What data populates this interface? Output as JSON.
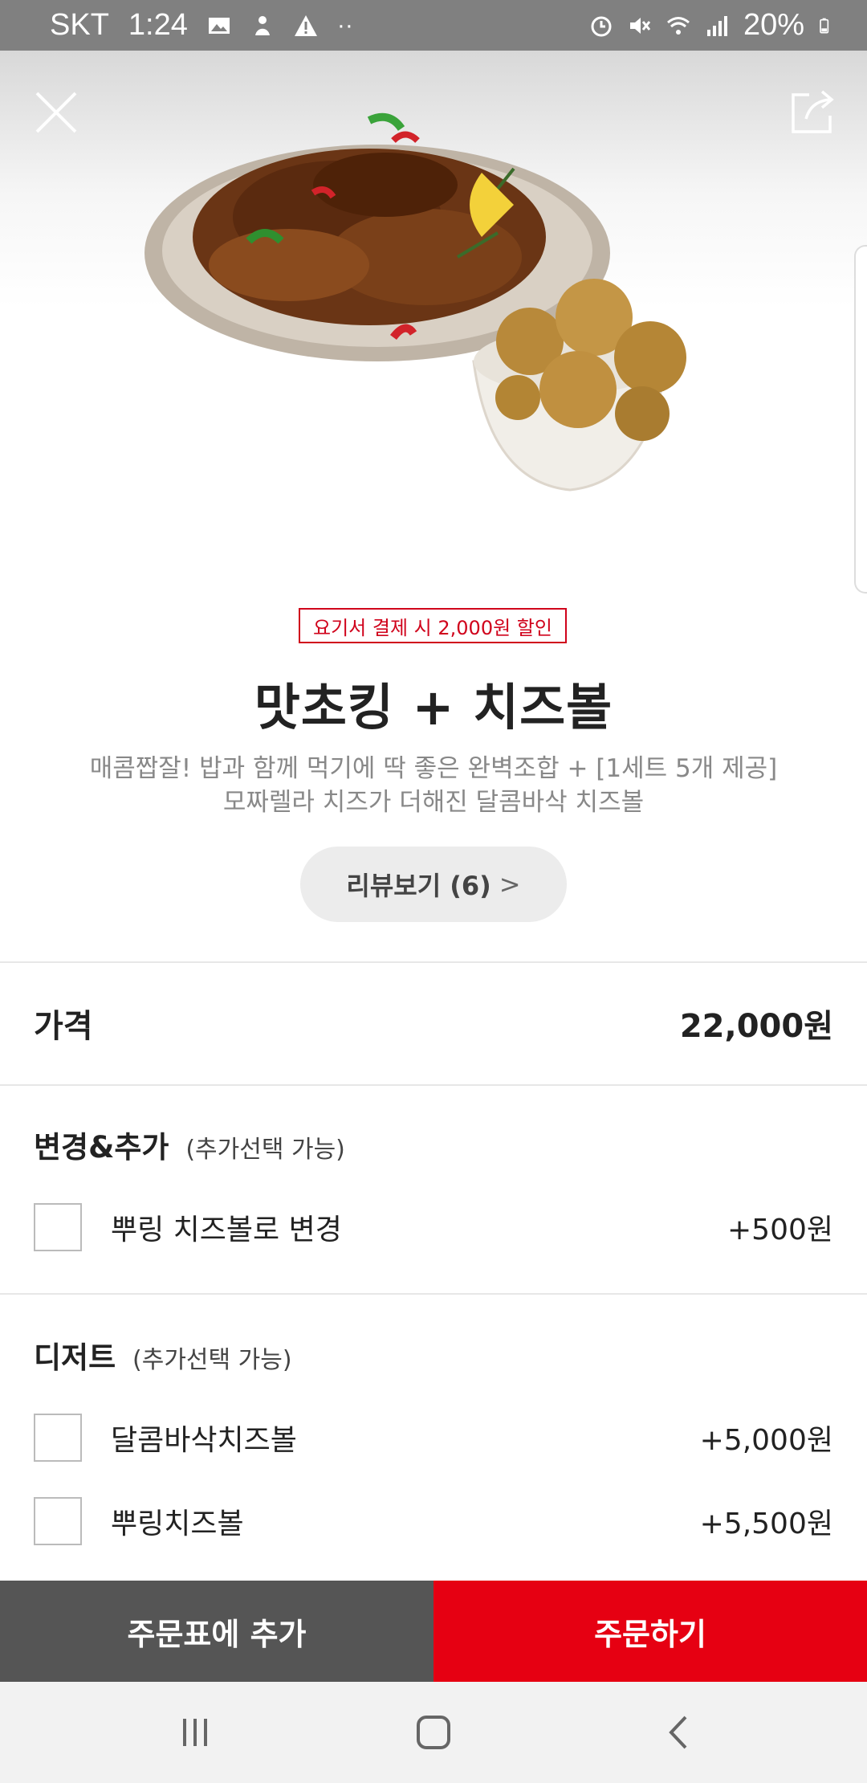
{
  "status_bar": {
    "carrier": "SKT",
    "time": "1:24",
    "battery": "20%",
    "left_icons": [
      "gallery-icon",
      "notification-figure-icon",
      "warning-icon",
      "more-dots-icon"
    ],
    "right_icons": [
      "alarm-icon",
      "mute-icon",
      "wifi-icon",
      "signal-icon",
      "battery-icon"
    ]
  },
  "header": {
    "close_icon": "close-icon",
    "share_icon": "share-icon"
  },
  "product": {
    "promo": "요기서 결제 시 2,000원 할인",
    "name": "맛초킹 + 치즈볼",
    "desc_line1": "매콤짭잘! 밥과 함께 먹기에 딱 좋은 완벽조합 + [1세트 5개 제공]",
    "desc_line2": "모짜렐라 치즈가 더해진 달콤바삭 치즈볼",
    "review_label": "리뷰보기 (6)",
    "review_chevron": ">"
  },
  "price_row": {
    "label": "가격",
    "value": "22,000원"
  },
  "section_change": {
    "title": "변경&추가",
    "note": "(추가선택 가능)",
    "options": [
      {
        "label": "뿌링 치즈볼로 변경",
        "price": "+500원",
        "checked": false
      }
    ]
  },
  "section_dessert": {
    "title": "디저트",
    "note": "(추가선택 가능)",
    "options": [
      {
        "label": "달콤바삭치즈볼",
        "price": "+5,000원",
        "checked": false
      },
      {
        "label": "뿌링치즈볼",
        "price": "+5,500원",
        "checked": false
      }
    ]
  },
  "actions": {
    "add_to_cart": "주문표에 추가",
    "order": "주문하기"
  },
  "colors": {
    "accent": "#e60012",
    "promo": "#d0021b",
    "dark_button": "#555555"
  }
}
